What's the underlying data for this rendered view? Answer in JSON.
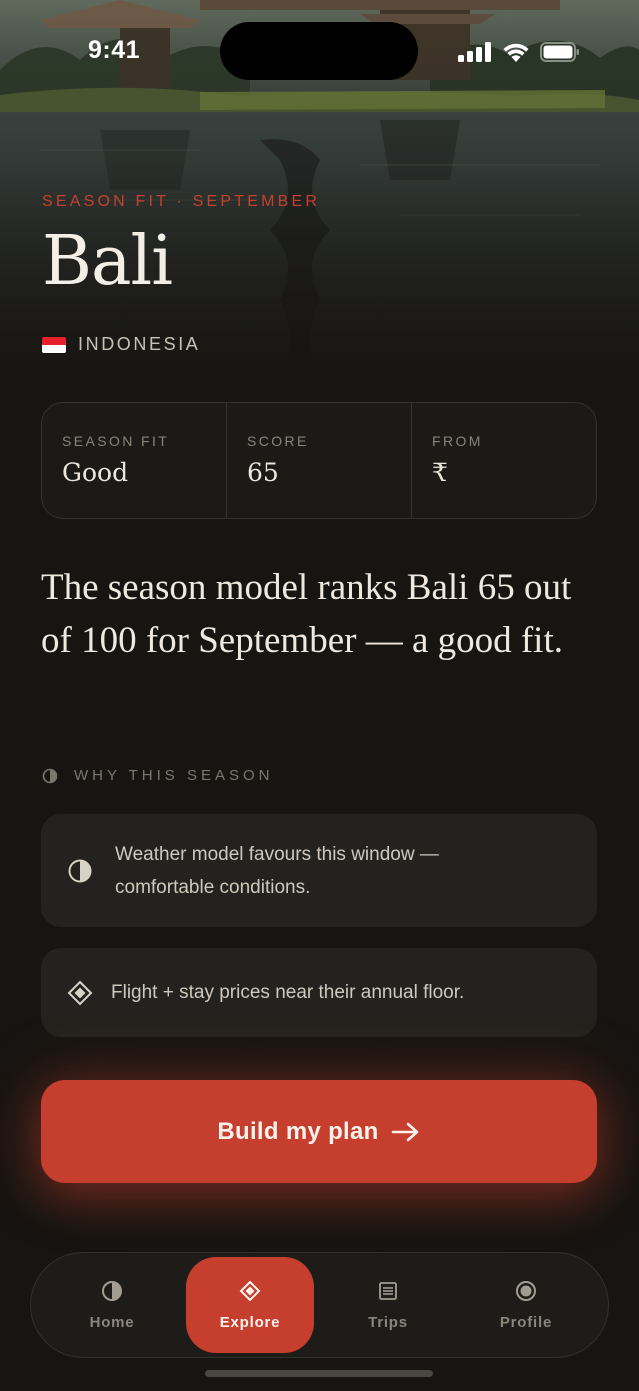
{
  "status_bar": {
    "time": "9:41"
  },
  "hero": {
    "eyebrow": "SEASON FIT · SEPTEMBER",
    "title": "Bali",
    "country": "INDONESIA",
    "flag_colors": [
      "#e8202e",
      "#ffffff"
    ]
  },
  "stats": [
    {
      "label": "SEASON FIT",
      "value": "Good"
    },
    {
      "label": "SCORE",
      "value": "65"
    },
    {
      "label": "FROM",
      "value": "₹"
    }
  ],
  "summary": "The season model ranks Bali 65 out of 100 for September — a good fit.",
  "why": {
    "heading": "WHY THIS SEASON",
    "heading_icon": "half-circle-icon",
    "reasons": [
      {
        "icon": "half-circle-icon",
        "text": "Weather model favours this window — comfortable conditions."
      },
      {
        "icon": "diamond-icon",
        "text": "Flight + stay prices near their annual floor."
      }
    ]
  },
  "cta": {
    "label": "Build my plan",
    "icon": "arrow-right-icon"
  },
  "tabs": [
    {
      "label": "Home",
      "icon": "half-circle-icon",
      "active": false
    },
    {
      "label": "Explore",
      "icon": "diamond-icon",
      "active": true
    },
    {
      "label": "Trips",
      "icon": "list-icon",
      "active": false
    },
    {
      "label": "Profile",
      "icon": "target-icon",
      "active": false
    }
  ],
  "colors": {
    "accent": "#c63e2d",
    "background": "#171512",
    "card": "#24221e"
  }
}
